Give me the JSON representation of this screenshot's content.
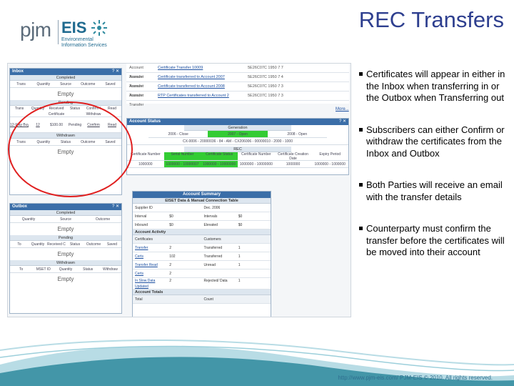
{
  "header": {
    "logo_pjm": "pjm",
    "logo_eis": "EIS",
    "logo_sub": "Environmental Information Services",
    "title": "REC Transfers"
  },
  "inbox": {
    "title": "Inbox",
    "controls": "? ✕",
    "section1": "Completed",
    "cols1": [
      "Trans",
      "Quantity",
      "Source",
      "Outcome",
      "Saved"
    ],
    "empty1": "Empty",
    "section2": "Pending",
    "cols2": [
      "Trans",
      "Quantity",
      "Received Certificate",
      "Status",
      "Confirm / Withdraw",
      "Read"
    ],
    "row2": [
      "12-Way Buyer",
      "12",
      "$100.00",
      "Pending",
      "Confirm",
      "Read"
    ],
    "section3": "Withdrawn",
    "cols3": [
      "Trans",
      "Quantity",
      "Status",
      "Outcome",
      "Saved"
    ],
    "empty3": "Empty"
  },
  "outbox": {
    "title": "Outbox",
    "controls": "? ✕",
    "section1": "Completed",
    "cols1": [
      "Quantity",
      "Source",
      "Outcome"
    ],
    "empty1": "Empty",
    "section2": "Pending",
    "cols2": [
      "To",
      "Quantity",
      "Received Certificate",
      "Status",
      "Outcome",
      "Saved"
    ],
    "empty2": "Empty",
    "section3": "Withdrawn",
    "cols3": [
      "To",
      "MSET ID",
      "Quantity",
      "Status",
      "Withdraw"
    ],
    "empty3": "Empty"
  },
  "transfer_list": [
    {
      "a": "Account Transfer",
      "b": "Certificate Transfer 10009",
      "c": "5E26C07C 1950 7 7"
    },
    {
      "a": "Account Transfer",
      "b": "Certificate transferred to Account 2007",
      "c": "5E26C07C 1950 7 4"
    },
    {
      "a": "Account Transfer",
      "b": "Certificate transferred to Account 2008",
      "c": "5E26C07C 1950 7 3"
    },
    {
      "a": "Account Transfer",
      "b": "RTP Certificates transferred to Account 2",
      "c": "5E26C07C 1950 7 3"
    }
  ],
  "more_link": "More...",
  "account_status": {
    "title": "Account Status",
    "controls": "? ✕",
    "generation_head": "Generation",
    "year_cols": [
      "2006 - Close",
      "2007 - Open",
      "2008 - Open"
    ],
    "serial_row": "CX-0006 - 20000036 - 84 - AM - CX206006 - 00000010 - 2000 - 1000",
    "sub_head": "REC",
    "cols": [
      "Certificate Number",
      "Serial Number",
      "Certificate Status",
      "Certificate Number",
      "Certificate Creation Date",
      "Expiry Period"
    ],
    "values": [
      "1000000",
      "1000000 - 10000007",
      "1000000 - 10000000",
      "1000000 - 10000000",
      "1000000",
      "1000000 - 1000000"
    ]
  },
  "summary": {
    "head": "Account Summary",
    "title": "EISET Data & Manual Connection Table",
    "supplier_label": "Supplier ID",
    "supplier_value": "Dec. 2006",
    "kv": [
      [
        "Interval",
        "$0",
        "Intervals",
        "$0"
      ],
      [
        "Inbound",
        "$0",
        "Elevated",
        "$0"
      ]
    ],
    "activity_head": "Account Activity",
    "activity_cols": [
      "Certificates",
      "Customers"
    ],
    "activity_rows": [
      [
        "Transfer",
        "2",
        "Transferred",
        "1"
      ],
      [
        "Certs",
        "102",
        "Transferred",
        "1"
      ],
      [
        "Transfer Read",
        "2",
        "Unread",
        "1"
      ],
      [
        "Certs",
        "2",
        "",
        ""
      ],
      [
        "In Slow Data Updated",
        "2",
        "Rejected/ Data",
        "1"
      ],
      [
        "",
        "",
        "",
        ""
      ]
    ],
    "totals_head": "Account Totals",
    "totals_cols": [
      "Total",
      "Count"
    ]
  },
  "bullets": [
    "Certificates will appear in either in the Inbox when transferring in or the Outbox when Transferring out",
    "Subscribers can either Confirm or withdraw the certificates from the Inbox and Outbox",
    "Both Parties will receive an email with the transfer details",
    "Counterparty must confirm the transfer before the certificates will be moved into their account"
  ],
  "footer": {
    "text": "http://www.pjm-eis.com/   PJM-EIS © 2010. All rights reserved."
  },
  "colors": {
    "title": "#2e3f8f",
    "panel_header": "#3b6ea8",
    "highlight": "#33cc33",
    "oval": "#e02020",
    "footer_wave": "#2e8a9e"
  }
}
